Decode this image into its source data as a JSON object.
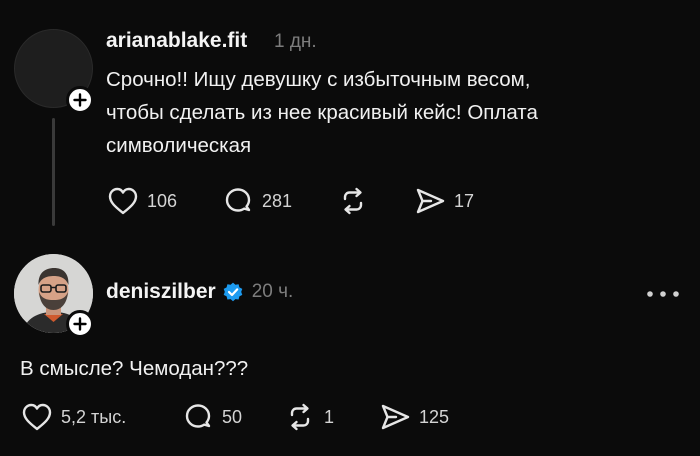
{
  "posts": [
    {
      "username": "arianablake.fit",
      "time": "1 дн.",
      "text_lines": [
        "Срочно!! Ищу девушку с избыточным весом,",
        "чтобы сделать из нее красивый кейс! Оплата",
        "символическая"
      ],
      "likes": "106",
      "replies": "281",
      "reposts": "",
      "shares": "17"
    },
    {
      "username": "deniszilber",
      "verified": true,
      "time": "20 ч.",
      "text": "В смысле? Чемодан???",
      "likes": "5,2 тыс.",
      "replies": "50",
      "reposts": "1",
      "shares": "125"
    }
  ],
  "icons": {
    "like": "heart-icon",
    "reply": "comment-icon",
    "repost": "repost-icon",
    "share": "send-icon",
    "follow": "plus-icon",
    "more": "more-icon",
    "verified": "verified-badge-icon"
  },
  "colors": {
    "background": "#0b0b0b",
    "verified": "#1d9bf0",
    "muted": "#7d7d7d"
  }
}
